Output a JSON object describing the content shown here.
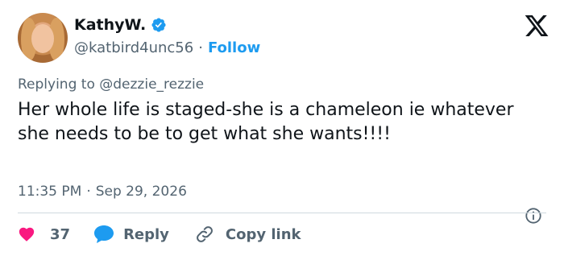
{
  "author": {
    "display_name": "KathyW.",
    "handle": "@katbird4unc56",
    "separator": "·",
    "follow_label": "Follow"
  },
  "reply_context": {
    "prefix": "Replying to ",
    "mention": "@dezzie_rezzie"
  },
  "tweet": {
    "text": "Her whole life is staged-she is a chameleon ie whatever she needs to be to get what she wants!!!!",
    "time": "11:35 PM",
    "separator": "·",
    "date": "Sep 29, 2026"
  },
  "actions": {
    "like_count": "37",
    "reply_label": "Reply",
    "copy_label": "Copy link"
  },
  "icons": {
    "verified": "verified-badge-icon",
    "logo": "x-logo-icon",
    "info": "info-icon",
    "like": "heart-icon",
    "reply": "speech-bubble-icon",
    "copy": "link-icon"
  },
  "colors": {
    "accent": "#1d9bf0",
    "like": "#f91880",
    "muted_text": "#536471",
    "text": "#0f1419"
  }
}
